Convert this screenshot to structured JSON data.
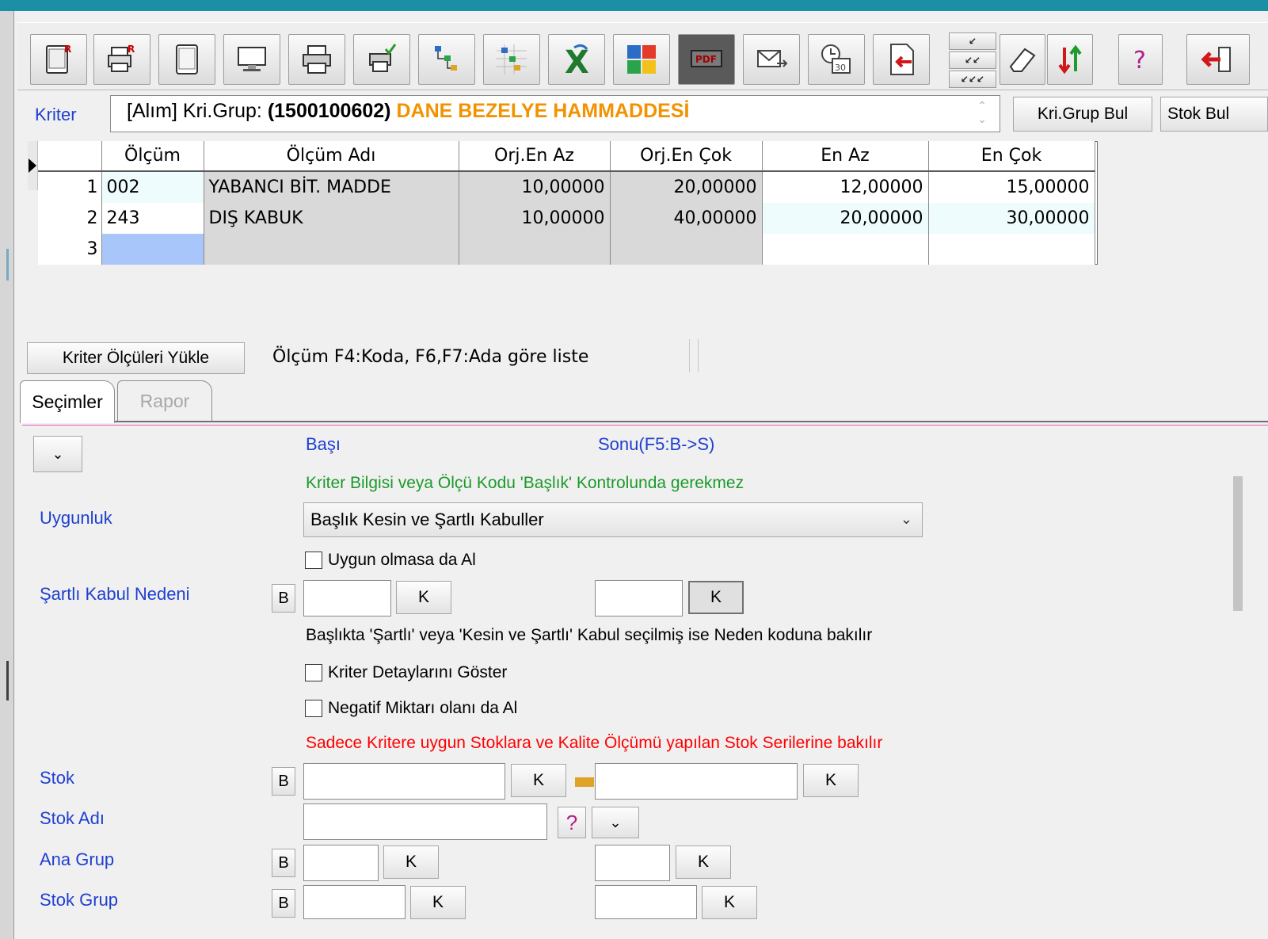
{
  "kriter": {
    "label": "Kriter",
    "prefix": "[Alım] Kri.Grup: ",
    "code": "(1500100602)",
    "name": "DANE BEZELYE HAMMADDESİ",
    "btn_grup": "Kri.Grup Bul",
    "btn_stok": "Stok Bul"
  },
  "grid": {
    "columns": [
      "Ölçüm",
      "Ölçüm Adı",
      "Orj.En Az",
      "Orj.En Çok",
      "En Az",
      "En Çok"
    ],
    "rows": [
      {
        "no": "1",
        "olcum": "002",
        "ad": "YABANCI BİT. MADDE",
        "orj_az": "10,00000",
        "orj_cok": "20,00000",
        "az": "12,00000",
        "cok": "15,00000"
      },
      {
        "no": "2",
        "olcum": "243",
        "ad": "DIŞ KABUK",
        "orj_az": "10,00000",
        "orj_cok": "40,00000",
        "az": "20,00000",
        "cok": "30,00000"
      },
      {
        "no": "3",
        "olcum": "",
        "ad": "",
        "orj_az": "",
        "orj_cok": "",
        "az": "",
        "cok": ""
      }
    ]
  },
  "load_button": "Kriter Ölçüleri Yükle",
  "hint": "Ölçüm F4:Koda, F6,F7:Ada göre liste",
  "tabs": {
    "secimler": "Seçimler",
    "rapor": "Rapor"
  },
  "form": {
    "basi": "Başı",
    "sonu": "Sonu(F5:B->S)",
    "note_green": "Kriter Bilgisi veya Ölçü Kodu 'Başlık' Kontrolunda gerekmez",
    "uygunluk_label": "Uygunluk",
    "uygunluk_value": "Başlık Kesin ve Şartlı Kabuller",
    "chk_uygun": "Uygun olmasa da Al",
    "sartli_label": "Şartlı Kabul Nedeni",
    "note_sartli": "Başlıkta 'Şartlı' veya 'Kesin ve Şartlı' Kabul seçilmiş ise Neden koduna bakılır",
    "chk_detay": "Kriter Detaylarını Göster",
    "chk_negatif": "Negatif Miktarı olanı da Al",
    "note_red": "Sadece Kritere uygun Stoklara ve Kalite Ölçümü yapılan Stok Serilerine bakılır",
    "stok_label": "Stok",
    "stok_adi_label": "Stok Adı",
    "ana_grup_label": "Ana Grup",
    "stok_grup_label": "Stok Grup",
    "b": "B",
    "k": "K",
    "question": "?"
  },
  "icons": [
    "tablet-r-icon",
    "printer-r-icon",
    "tablet-icon",
    "monitor-icon",
    "printer-icon",
    "printer-check-icon",
    "tree-icon",
    "tree-grid-icon",
    "excel-icon",
    "puzzle-icon",
    "pdf-icon",
    "mail-icon",
    "calendar-clock-icon",
    "import-icon",
    "levels-icon",
    "eraser-icon",
    "sort-icon",
    "help-icon",
    "exit-icon"
  ],
  "colors": {
    "accent": "#1f3fd0",
    "orange": "#f39200",
    "green": "#1c9a2a",
    "red": "#ff0000",
    "topbar": "#1a8fa6"
  }
}
